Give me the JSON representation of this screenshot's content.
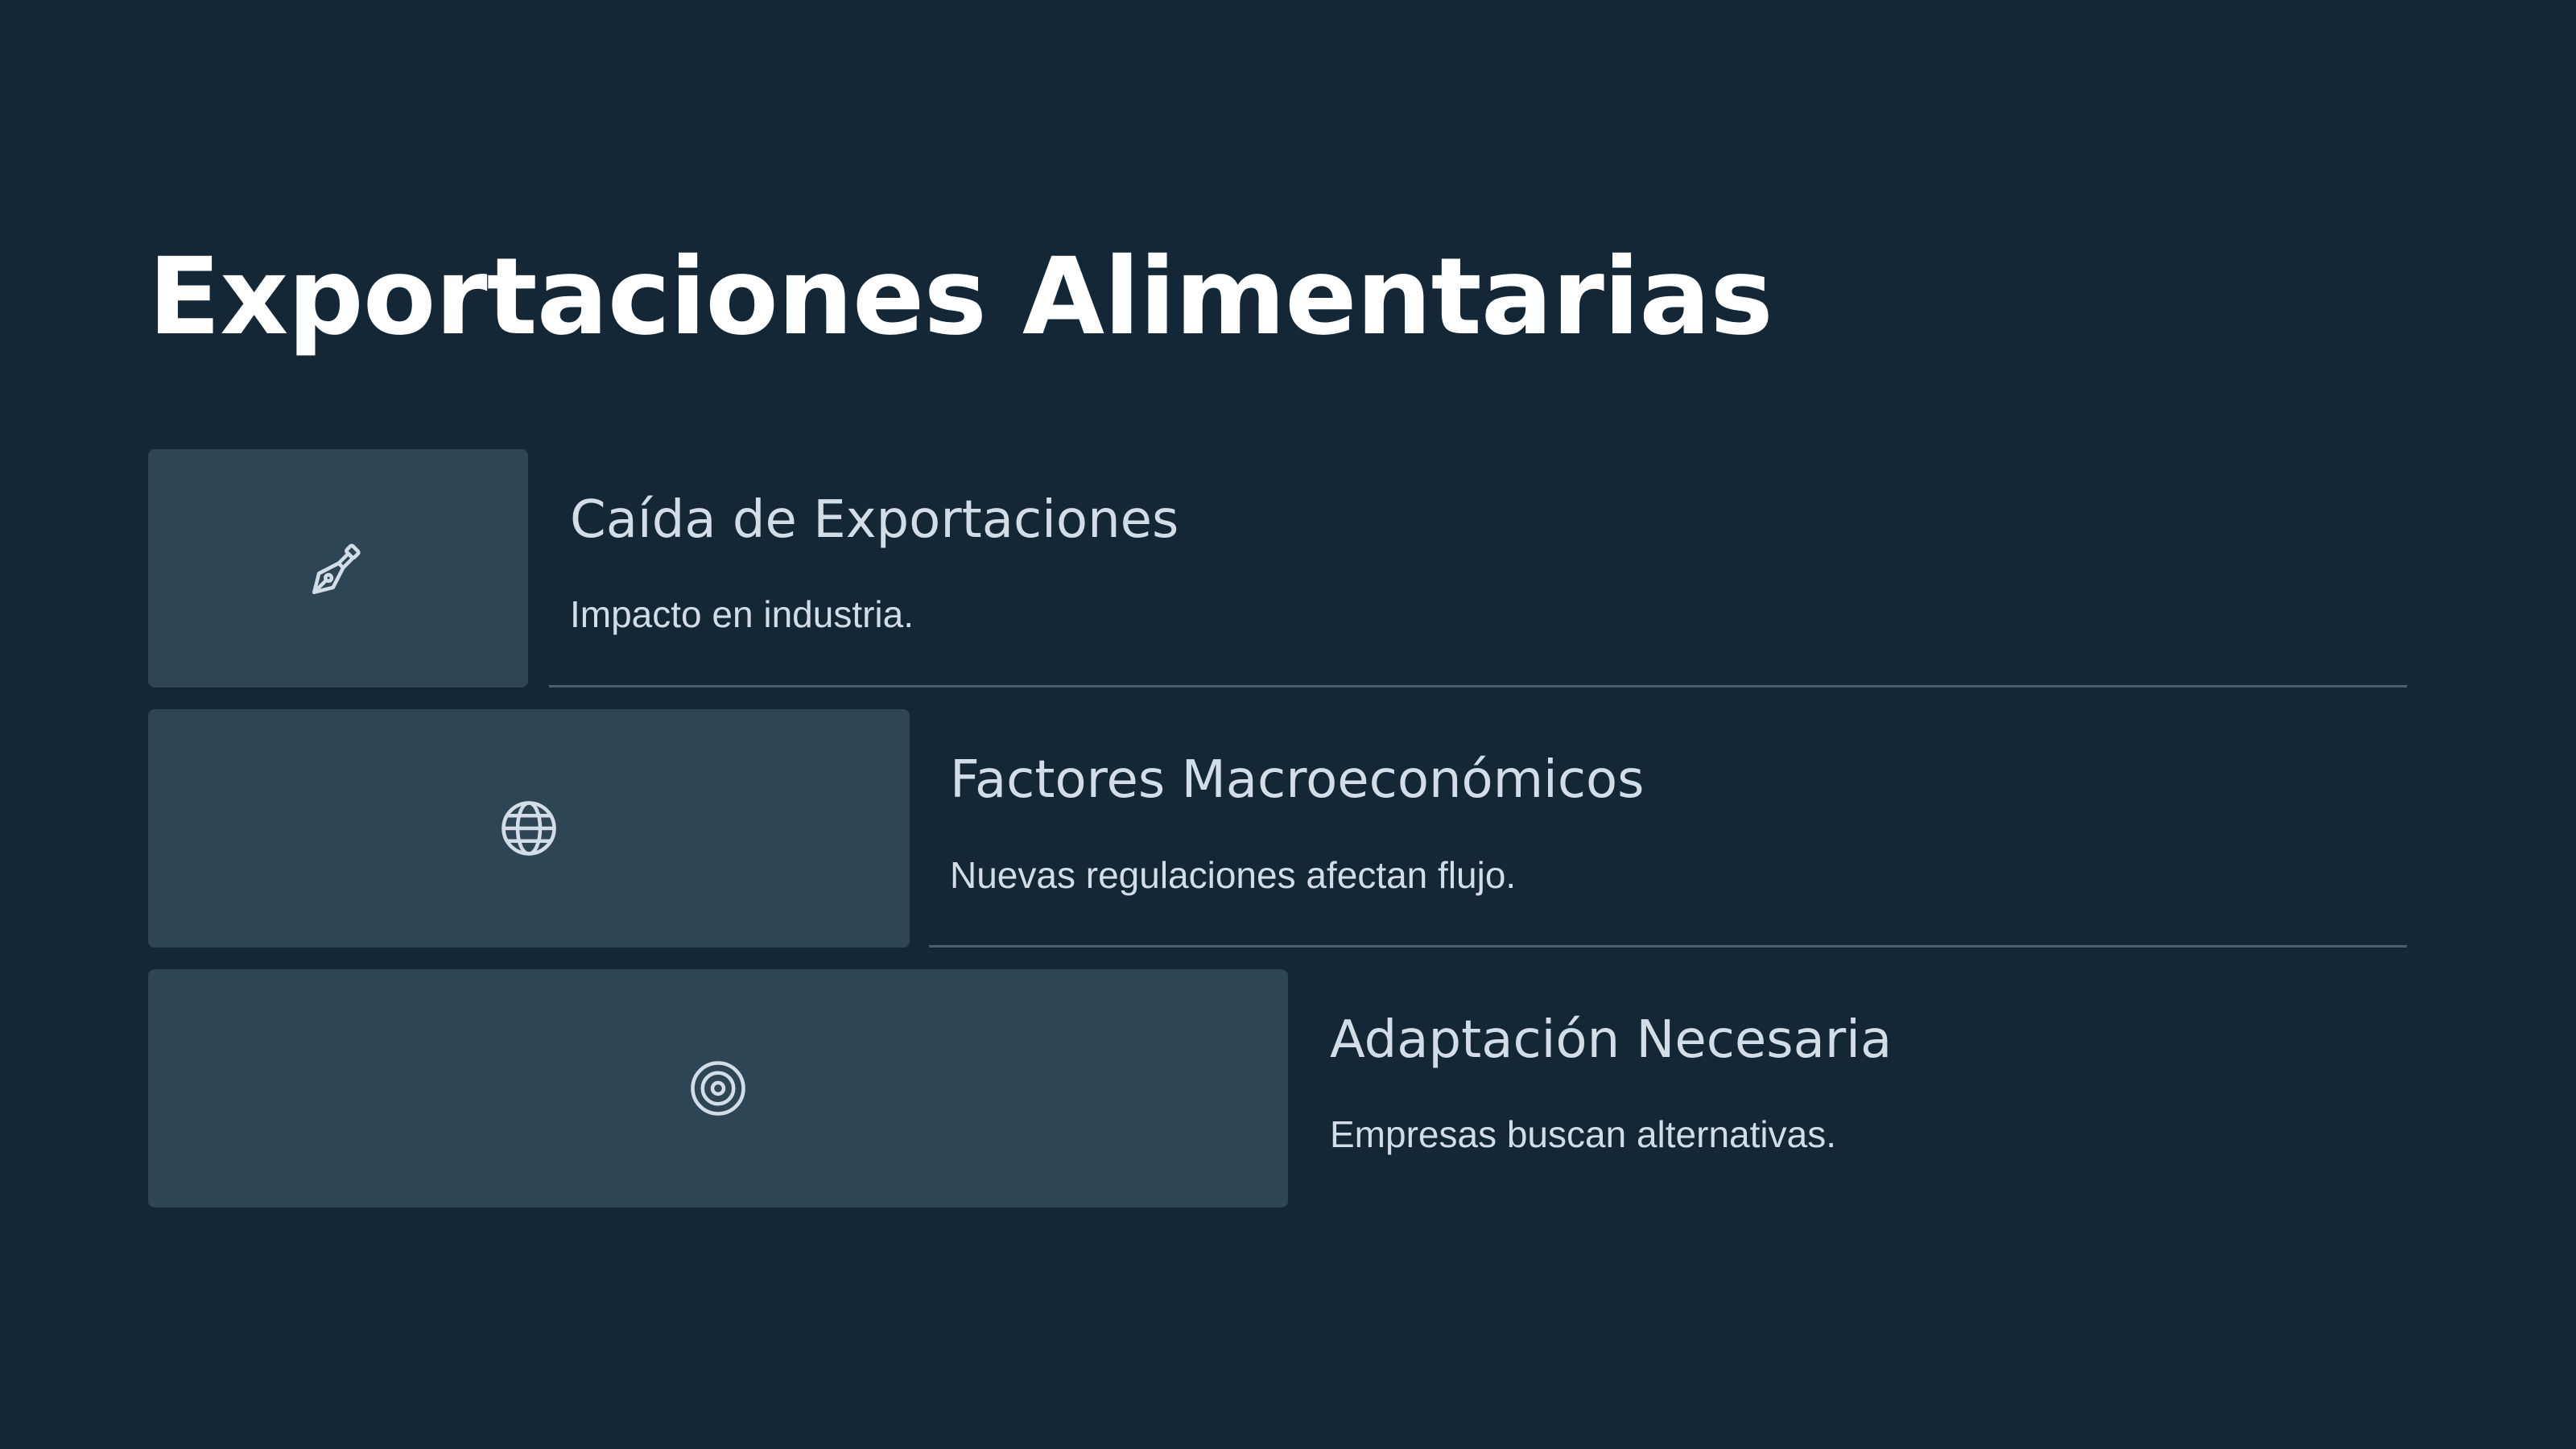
{
  "slide": {
    "title": "Exportaciones Alimentarias",
    "items": [
      {
        "icon": "pen-nib-icon",
        "heading": "Caída de Exportaciones",
        "description": "Impacto en industria."
      },
      {
        "icon": "globe-icon",
        "heading": "Factores Macroeconómicos",
        "description": "Nuevas regulaciones afectan flujo."
      },
      {
        "icon": "target-icon",
        "heading": "Adaptación Necesaria",
        "description": "Empresas buscan alternativas."
      }
    ]
  },
  "colors": {
    "background": "#132737",
    "block": "#2e4555",
    "text": "#d3dde7",
    "title": "#ffffff",
    "divider": "#4a5e6d"
  }
}
